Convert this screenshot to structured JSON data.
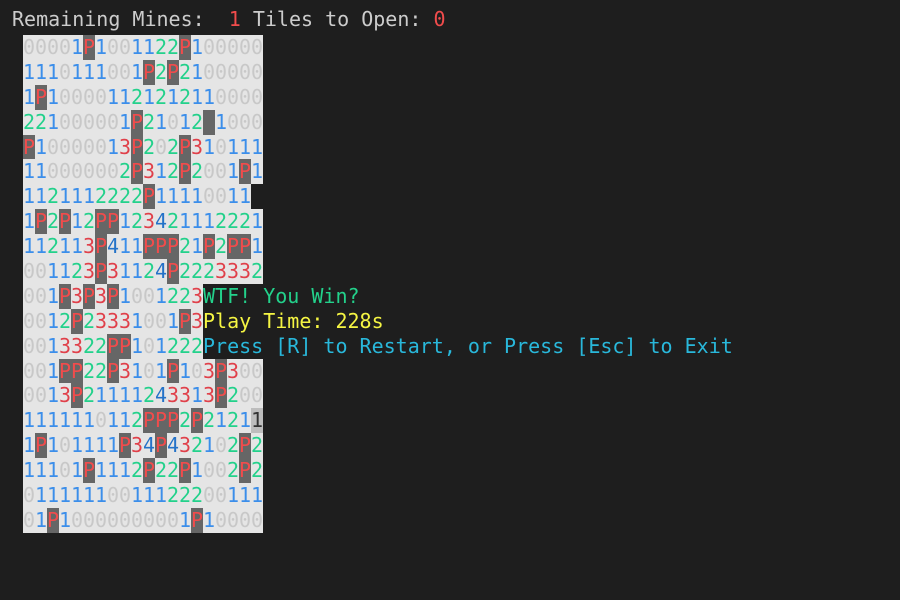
{
  "header": {
    "mines_label": "Remaining Mines: ",
    "mines_value": "1",
    "tiles_label": "Tiles to Open:",
    "tiles_value": "0"
  },
  "board": {
    "rows": [
      "00001P1001122P100000",
      "1110111001P2P2100000",
      "1P100001121212110000",
      "221000001P21012.10000",
      "P10000013P202P310111",
      "110000002P312P2001P1",
      "11211122 22P11110011",
      "1P2P12PP123421112221",
      "112113P411PPP21P2PP1",
      "001123P31124P2223332",
      "001P3P3P1001223",
      "0012P23331001P3",
      "001332 2PP101222",
      "001PP22P3101P103P300",
      "0013P2111124331 3P200",
      "1111110112PPP2P21211",
      "1P101111P34P432102P2",
      "11101P1112P22P1002P2",
      "01111110011122200111",
      "01P10000000001P10000"
    ],
    "cursor": {
      "row": 15,
      "col": 19
    },
    "legend": {
      "flag": "P",
      "covered": "."
    }
  },
  "messages": {
    "win": "WTF! You Win?",
    "play_time": "Play Time: 228s",
    "instructions": "Press [R] to Restart, or Press [Esc] to Exit"
  },
  "colors": {
    "background": "#1e1e1e",
    "win": "#23d18b",
    "play_time": "#f5f543",
    "instructions": "#29b8db",
    "counter": "#f14c4c"
  }
}
